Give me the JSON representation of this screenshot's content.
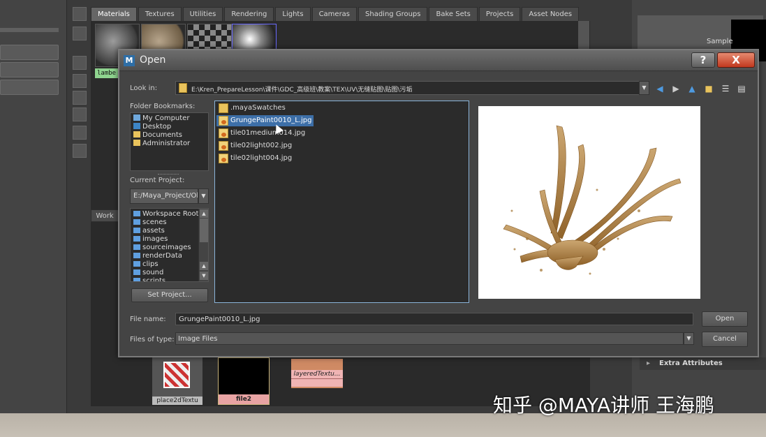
{
  "hypershade": {
    "tabs": [
      "Materials",
      "Textures",
      "Utilities",
      "Rendering",
      "Lights",
      "Cameras",
      "Shading Groups",
      "Bake Sets",
      "Projects",
      "Asset Nodes"
    ],
    "active_tab": "Materials",
    "lambert_label": "lambe",
    "work_tab": "Work",
    "nodes": {
      "place2d": "place2dTextu",
      "file2": "file2",
      "layered": "layeredTextu..."
    }
  },
  "attribute_panel": {
    "sample_label": "Sample",
    "extra_attributes": "Extra Attributes"
  },
  "dialog": {
    "title": "Open",
    "help_label": "?",
    "close_label": "X",
    "lookin_label": "Look in:",
    "lookin_path": "E:\\Kren_PrepareLesson\\课件\\GDC_高级班\\教案\\TEX\\UV\\无缝贴图\\贴图\\污垢",
    "bookmarks_label": "Folder Bookmarks:",
    "bookmarks": [
      "My Computer",
      "Desktop",
      "Documents",
      "Administrator"
    ],
    "current_project_label": "Current Project:",
    "current_project": "E:/Maya_Project/Olc",
    "workspace_items": [
      "Workspace Root",
      "scenes",
      "assets",
      "images",
      "sourceimages",
      "renderData",
      "clips",
      "sound",
      "scripts"
    ],
    "set_project_label": "Set Project...",
    "files": [
      {
        "name": ".mayaSwatches",
        "type": "folder"
      },
      {
        "name": "GrungePaint0010_L.jpg",
        "type": "image",
        "selected": true
      },
      {
        "name": "tile01medium014.jpg",
        "type": "image"
      },
      {
        "name": "tile02light002.jpg",
        "type": "image"
      },
      {
        "name": "tile02light004.jpg",
        "type": "image"
      }
    ],
    "file_name_label": "File name:",
    "file_name_value": "GrungePaint0010_L.jpg",
    "file_type_label": "Files of type:",
    "file_type_value": "Image Files",
    "open_label": "Open",
    "cancel_label": "Cancel"
  },
  "watermark": "知乎 @MAYA讲师 王海鹏"
}
